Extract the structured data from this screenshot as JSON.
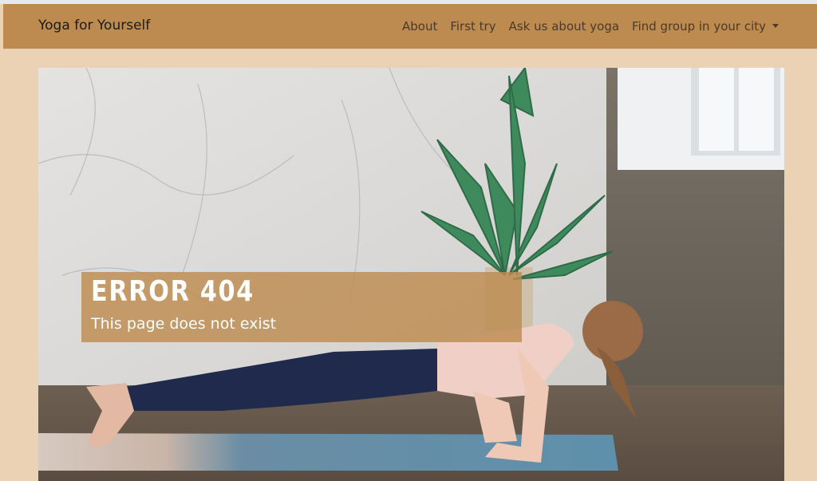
{
  "navbar": {
    "brand": "Yoga for Yourself",
    "links": [
      {
        "label": "About"
      },
      {
        "label": "First try"
      },
      {
        "label": "Ask us about yoga"
      },
      {
        "label": "Find group in your city"
      }
    ]
  },
  "hero": {
    "image": "photo of woman doing plank pose on yoga mat next to palm plant",
    "error_title": "ERROR 404",
    "error_message": "This page does not exist"
  },
  "colors": {
    "navbar_bg": "#bd8b4f",
    "page_bg": "#ebd2b4",
    "overlay": "#bd8b4f"
  }
}
